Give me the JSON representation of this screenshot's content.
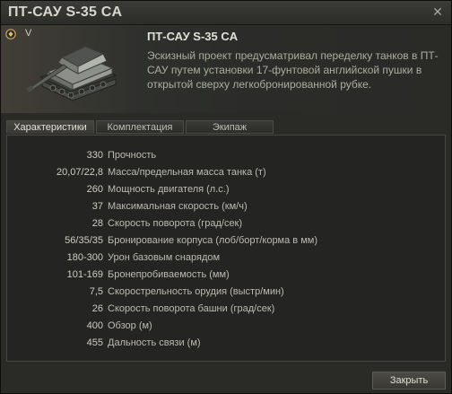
{
  "window": {
    "title": "ПТ-САУ S-35 CA",
    "close_glyph": "✕"
  },
  "tank": {
    "tier": "V",
    "name": "ПТ-САУ S-35 CA",
    "description": "Эскизный проект предусматривал переделку танков в ПТ-САУ путем установки 17-фунтовой английской пушки в открытой сверху легкобронированной рубке.",
    "nation_icon": "france-flag-icon",
    "type_icon": "tank-destroyer-icon"
  },
  "tabs": [
    {
      "label": "Характеристики",
      "active": true
    },
    {
      "label": "Комплектация",
      "active": false
    },
    {
      "label": "Экипаж",
      "active": false
    }
  ],
  "stats": [
    {
      "value": "330",
      "label": "Прочность"
    },
    {
      "value": "20,07/22,8",
      "label": "Масса/предельная масса танка (т)"
    },
    {
      "value": "260",
      "label": "Мощность двигателя (л.с.)"
    },
    {
      "value": "37",
      "label": "Максимальная скорость (км/ч)"
    },
    {
      "value": "28",
      "label": "Скорость поворота (град/сек)"
    },
    {
      "value": "56/35/35",
      "label": "Бронирование корпуса (лоб/борт/корма в мм)"
    },
    {
      "value": "180-300",
      "label": "Урон базовым снарядом"
    },
    {
      "value": "101-169",
      "label": "Бронепробиваемость (мм)"
    },
    {
      "value": "7,5",
      "label": "Скорострельность орудия (выстр/мин)"
    },
    {
      "value": "26",
      "label": "Скорость поворота башни (град/сек)"
    },
    {
      "value": "400",
      "label": "Обзор (м)"
    },
    {
      "value": "455",
      "label": "Дальность связи (м)"
    }
  ],
  "footer": {
    "close_label": "Закрыть"
  },
  "colors": {
    "background": "#2a2a27",
    "panel": "#242422",
    "text": "#bdbcb3"
  }
}
